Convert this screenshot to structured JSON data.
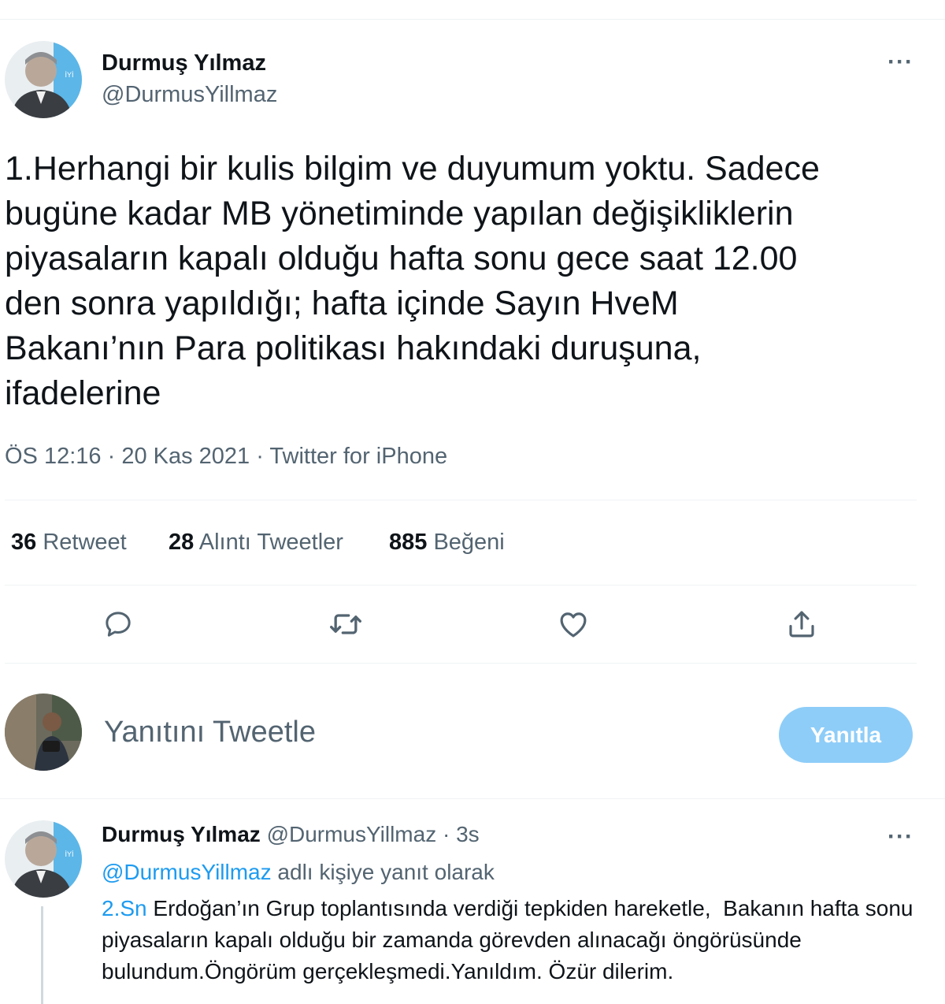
{
  "tweet": {
    "author_name": "Durmuş Yılmaz",
    "author_handle": "@DurmusYillmaz",
    "more_label": "···",
    "text": "1.Herhangi bir kulis bilgim ve duyumum yoktu. Sadece\nbugüne kadar MB yönetiminde yapılan değişikliklerin\npiyasaların kapalı olduğu hafta sonu gece saat 12.00\nden sonra yapıldığı; hafta içinde Sayın HveM\nBakanı’nın Para politikası hakındaki duruşuna,\nifadelerine",
    "time": "ÖS 12:16",
    "separator": " · ",
    "date": "20 Kas 2021",
    "source": "Twitter for iPhone",
    "avatar_badge": "İYİ"
  },
  "stats": {
    "retweets_count": "36",
    "retweets_label": "Retweet",
    "quotes_count": "28",
    "quotes_label": "Alıntı Tweetler",
    "likes_count": "885",
    "likes_label": "Beğeni"
  },
  "actions": [
    "reply-icon",
    "retweet-icon",
    "like-icon",
    "share-icon"
  ],
  "compose": {
    "placeholder": "Yanıtını Tweetle",
    "button_label": "Yanıtla"
  },
  "reply": {
    "author_name": "Durmuş Yılmaz",
    "author_handle": "@DurmusYillmaz",
    "dot": " · ",
    "time": "3s",
    "more_label": "···",
    "replying_handle": "@DurmusYillmaz",
    "replying_suffix": " adlı kişiye yanıt olarak",
    "text_link": "2.Sn",
    "text": " Erdoğan’ın Grup toplantısında verdiği tepkiden hareketle,  Bakanın hafta sonu piyasaların kapalı olduğu bir zamanda görevden alınacağı öngörüsünde bulundum.Öngörüm gerçekleşmedi.Yanıldım. Özür dilerim."
  },
  "colors": {
    "accent": "#1d9bf0",
    "muted": "#536471",
    "button_disabled": "#8ecdf8"
  }
}
